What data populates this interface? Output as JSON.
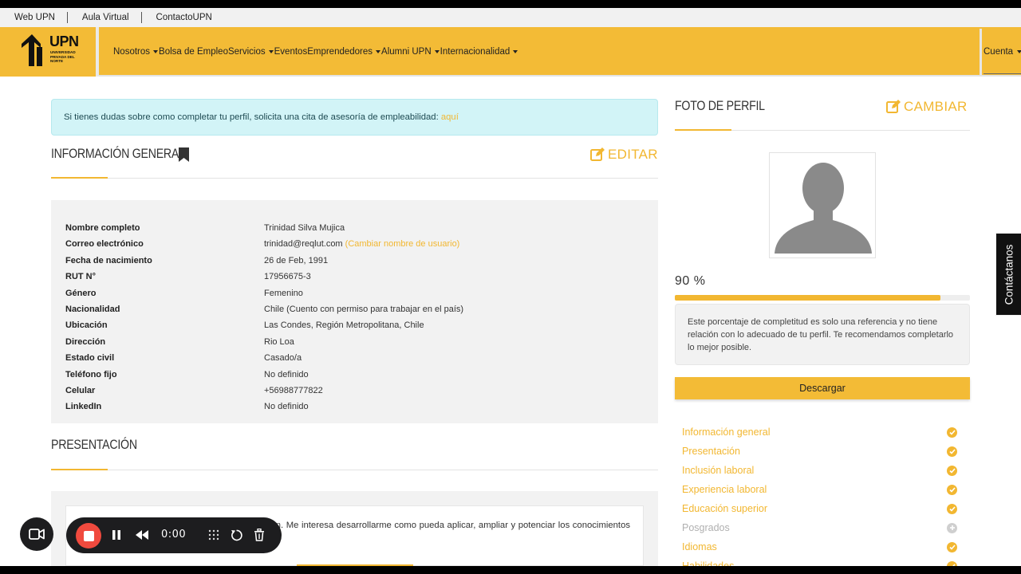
{
  "util_links": [
    "Web UPN",
    "Aula Virtual",
    "ContactoUPN"
  ],
  "brand": {
    "name": "UPN",
    "subtitle": "UNIVERSIDAD PRIVADA DEL NORTE",
    "accent": "#f3bb36"
  },
  "nav": {
    "items": [
      {
        "label": "Nosotros",
        "dropdown": true
      },
      {
        "label": "Bolsa de Empleo",
        "dropdown": false
      },
      {
        "label": "Servicios",
        "dropdown": true
      },
      {
        "label": "Eventos",
        "dropdown": false
      },
      {
        "label": "Emprendedores",
        "dropdown": true
      },
      {
        "label": "Alumni UPN",
        "dropdown": true
      },
      {
        "label": "Internacionalidad",
        "dropdown": true
      }
    ],
    "account_label": "Cuenta"
  },
  "alert": {
    "text": "Si tienes dudas sobre como completar tu perfil, solicita una cita de asesoría de empleabilidad: ",
    "link": "aquí"
  },
  "general": {
    "title": "Información general",
    "edit_label": "Editar",
    "rows": [
      {
        "label": "Nombre completo",
        "value": "Trinidad Silva Mujica",
        "link": ""
      },
      {
        "label": "Correo electrónico",
        "value": "trinidad@reqlut.com",
        "link": "(Cambiar nombre de usuario)"
      },
      {
        "label": "Fecha de nacimiento",
        "value": "26 de Feb, 1991",
        "link": ""
      },
      {
        "label": "RUT N°",
        "value": "17956675-3",
        "link": ""
      },
      {
        "label": "Género",
        "value": "Femenino",
        "link": ""
      },
      {
        "label": "Nacionalidad",
        "value": "Chile (Cuento con permiso para trabajar en el país)",
        "link": ""
      },
      {
        "label": "Ubicación",
        "value": "Las Condes, Región Metropolitana, Chile",
        "link": ""
      },
      {
        "label": "Dirección",
        "value": "Rio Loa",
        "link": ""
      },
      {
        "label": "Estado civil",
        "value": "Casado/a",
        "link": ""
      },
      {
        "label": "Teléfono fijo",
        "value": "No definido",
        "link": ""
      },
      {
        "label": "Celular",
        "value": "+56988777822",
        "link": ""
      },
      {
        "label": "LinkedIn",
        "value": "No definido",
        "link": ""
      }
    ]
  },
  "presentation": {
    "title": "Presentación",
    "text": "de experiencia en el área de servicios & distribución. Me interesa desarrollarme como pueda aplicar, ampliar y potenciar los conocimientos y competencias adquiridas en mi"
  },
  "profile_photo": {
    "title": "Foto de perfil",
    "change_label": "Cambiar"
  },
  "completion": {
    "percent_label": "90 %",
    "percent_value": 0.9,
    "note": "Este porcentaje de completitud es solo una referencia y no tiene relación con lo adecuado de tu perfil. Te recomendamos completarlo lo mejor posible.",
    "download_label": "Descargar"
  },
  "checklist": [
    {
      "label": "Información general",
      "done": true
    },
    {
      "label": "Presentación",
      "done": true
    },
    {
      "label": "Inclusión laboral",
      "done": true
    },
    {
      "label": "Experiencia laboral",
      "done": true
    },
    {
      "label": "Educación superior",
      "done": true
    },
    {
      "label": "Posgrados",
      "done": false
    },
    {
      "label": "Idiomas",
      "done": true
    },
    {
      "label": "Habilidades",
      "done": true
    }
  ],
  "side_tab": "Contáctanos",
  "recorder": {
    "time": "0:00"
  }
}
